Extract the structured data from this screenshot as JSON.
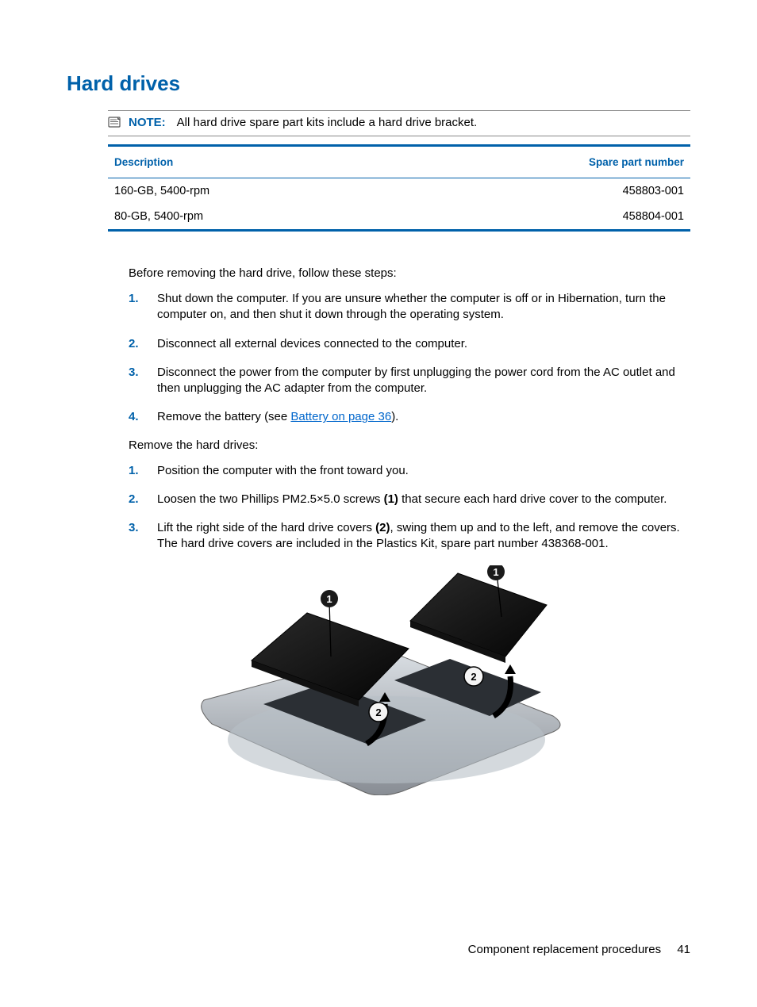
{
  "heading": "Hard drives",
  "note": {
    "label": "NOTE:",
    "text": "All hard drive spare part kits include a hard drive bracket."
  },
  "table": {
    "headers": {
      "desc": "Description",
      "spare": "Spare part number"
    },
    "rows": [
      {
        "desc": "160-GB, 5400-rpm",
        "spare": "458803-001"
      },
      {
        "desc": "80-GB, 5400-rpm",
        "spare": "458804-001"
      }
    ]
  },
  "intro1": "Before removing the hard drive, follow these steps:",
  "steps1": [
    {
      "n": "1.",
      "t": "Shut down the computer. If you are unsure whether the computer is off or in Hibernation, turn the computer on, and then shut it down through the operating system."
    },
    {
      "n": "2.",
      "t": "Disconnect all external devices connected to the computer."
    },
    {
      "n": "3.",
      "t": "Disconnect the power from the computer by first unplugging the power cord from the AC outlet and then unplugging the AC adapter from the computer."
    },
    {
      "n": "4.",
      "pre": "Remove the battery (see ",
      "link": "Battery on page 36",
      "post": ")."
    }
  ],
  "intro2": "Remove the hard drives:",
  "steps2": [
    {
      "n": "1.",
      "t": "Position the computer with the front toward you."
    },
    {
      "n": "2.",
      "pre": "Loosen the two Phillips PM2.5×5.0 screws ",
      "b": "(1)",
      "post": " that secure each hard drive cover to the computer."
    },
    {
      "n": "3.",
      "pre": "Lift the right side of the hard drive covers ",
      "b": "(2)",
      "post": ", swing them up and to the left, and remove the covers. The hard drive covers are included in the Plastics Kit, spare part number 438368-001."
    }
  ],
  "footer": {
    "section": "Component replacement procedures",
    "page": "41"
  }
}
